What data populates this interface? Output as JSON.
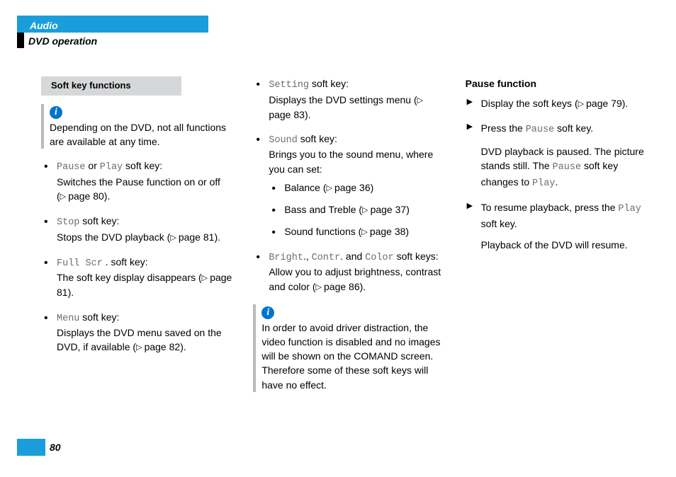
{
  "header": {
    "section": "Audio",
    "title": "DVD operation"
  },
  "col1": {
    "heading": "Soft key functions",
    "info": "Depending on the DVD, not all functions are available at any time.",
    "items": [
      {
        "key1": "Pause",
        "mid": " or ",
        "key2": "Play",
        "tail": " soft key:",
        "desc": "Switches the Pause function on or off ",
        "ref": "page 80"
      },
      {
        "key1": "Stop",
        "tail": " soft key:",
        "desc": "Stops the DVD playback ",
        "ref": "page 81"
      },
      {
        "key1": "Full Scr",
        "tail": ". soft key:",
        "desc": "The soft key display disappears ",
        "ref": "page 81"
      },
      {
        "key1": "Menu",
        "tail": " soft key:",
        "desc": "Displays the DVD menu saved on the DVD, if available ",
        "ref": "page 82"
      }
    ]
  },
  "col2": {
    "items": [
      {
        "key1": "Setting",
        "tail": " soft key:",
        "desc": "Displays the DVD settings menu ",
        "ref": "page 83"
      },
      {
        "key1": "Sound",
        "tail": " soft key:",
        "desc": "Brings you to the sound menu, where you can set:",
        "sub": [
          {
            "label": "Balance ",
            "ref": "page 36"
          },
          {
            "label": "Bass and Treble ",
            "ref": "page 37"
          },
          {
            "label": "Sound functions ",
            "ref": "page 38"
          }
        ]
      },
      {
        "key1": "Bright",
        "key2": "Contr",
        "key3": "Color",
        "tail": " soft keys:",
        "desc": "Allow you to adjust brightness, contrast and color ",
        "ref": "page 86"
      }
    ],
    "info": "In order to avoid driver distraction, the video function is disabled and no images will be shown on the COMAND screen. Therefore some of these soft keys will have no effect."
  },
  "col3": {
    "heading": "Pause function",
    "steps": [
      {
        "text": "Display the soft keys ",
        "ref": "page 79"
      },
      {
        "pre": "Press the ",
        "key": "Pause",
        "post": " soft key."
      },
      {
        "pre": "To resume playback, press the ",
        "key": "Play",
        "post": " soft key."
      }
    ],
    "para1a": "DVD playback is paused. The picture stands still. The ",
    "para1key": "Pause",
    "para1b": " soft key changes to ",
    "para1key2": "Play",
    "para2": "Playback of the DVD will resume."
  },
  "footer": {
    "page": "80"
  }
}
